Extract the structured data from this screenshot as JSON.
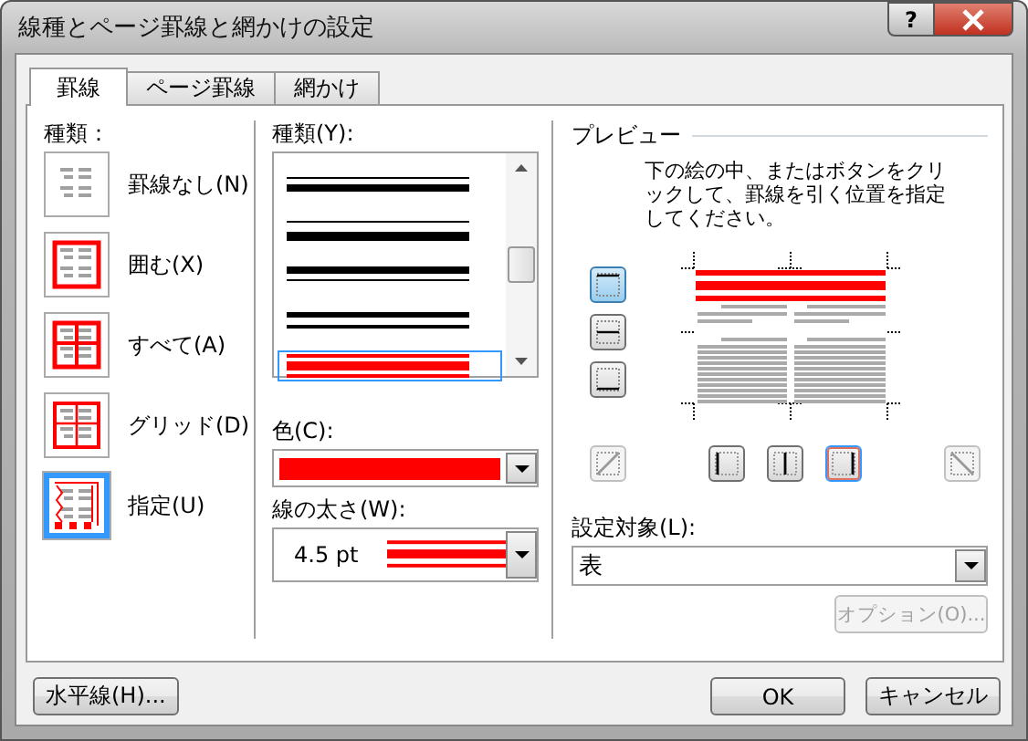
{
  "window": {
    "title": "線種とページ罫線と網かけの設定",
    "help": "?"
  },
  "tabs": [
    {
      "label": "罫線",
      "selected": true
    },
    {
      "label": "ページ罫線",
      "selected": false
    },
    {
      "label": "網かけ",
      "selected": false
    }
  ],
  "setting": {
    "label": "種類：",
    "items": [
      {
        "kind": "none",
        "label": "罫線なし(N)",
        "selected": false
      },
      {
        "kind": "box",
        "label": "囲む(X)",
        "selected": false
      },
      {
        "kind": "all",
        "label": "すべて(A)",
        "selected": false
      },
      {
        "kind": "grid",
        "label": "グリッド(D)",
        "selected": false
      },
      {
        "kind": "custom",
        "label": "指定(U)",
        "selected": true
      }
    ]
  },
  "style": {
    "label": "種類(Y):",
    "items": [
      {
        "kind": "thin-thick",
        "selected": false
      },
      {
        "kind": "thin-thick-wide",
        "selected": false
      },
      {
        "kind": "thick-thin",
        "selected": false
      },
      {
        "kind": "thick-thin-wide",
        "selected": false
      },
      {
        "kind": "thin-thick-thin",
        "selected": true
      }
    ]
  },
  "color": {
    "label": "色(C):",
    "color": "#ff0000"
  },
  "width": {
    "label": "線の太さ(W):",
    "value": "4.5 pt"
  },
  "preview": {
    "title": "プレビュー",
    "instructions": "下の絵の中、またはボタンをクリックして、罫線を引く位置を指定してください。",
    "side_buttons": [
      {
        "kind": "top",
        "on": true
      },
      {
        "kind": "middle",
        "on": false
      },
      {
        "kind": "bottom",
        "on": false
      }
    ],
    "bottom_buttons": [
      {
        "kind": "diag-up",
        "on": false,
        "disabled": true
      },
      {
        "kind": "left",
        "on": false,
        "disabled": false
      },
      {
        "kind": "inner",
        "on": false,
        "disabled": false
      },
      {
        "kind": "right",
        "on": true,
        "disabled": false
      },
      {
        "kind": "diag-down",
        "on": false,
        "disabled": true
      }
    ]
  },
  "apply": {
    "label": "設定対象(L):",
    "value": "表",
    "options_button": "オプション(O)...",
    "options_disabled": true
  },
  "footer": {
    "horizontal_line": "水平線(H)...",
    "ok": "OK",
    "cancel": "キャンセル"
  }
}
